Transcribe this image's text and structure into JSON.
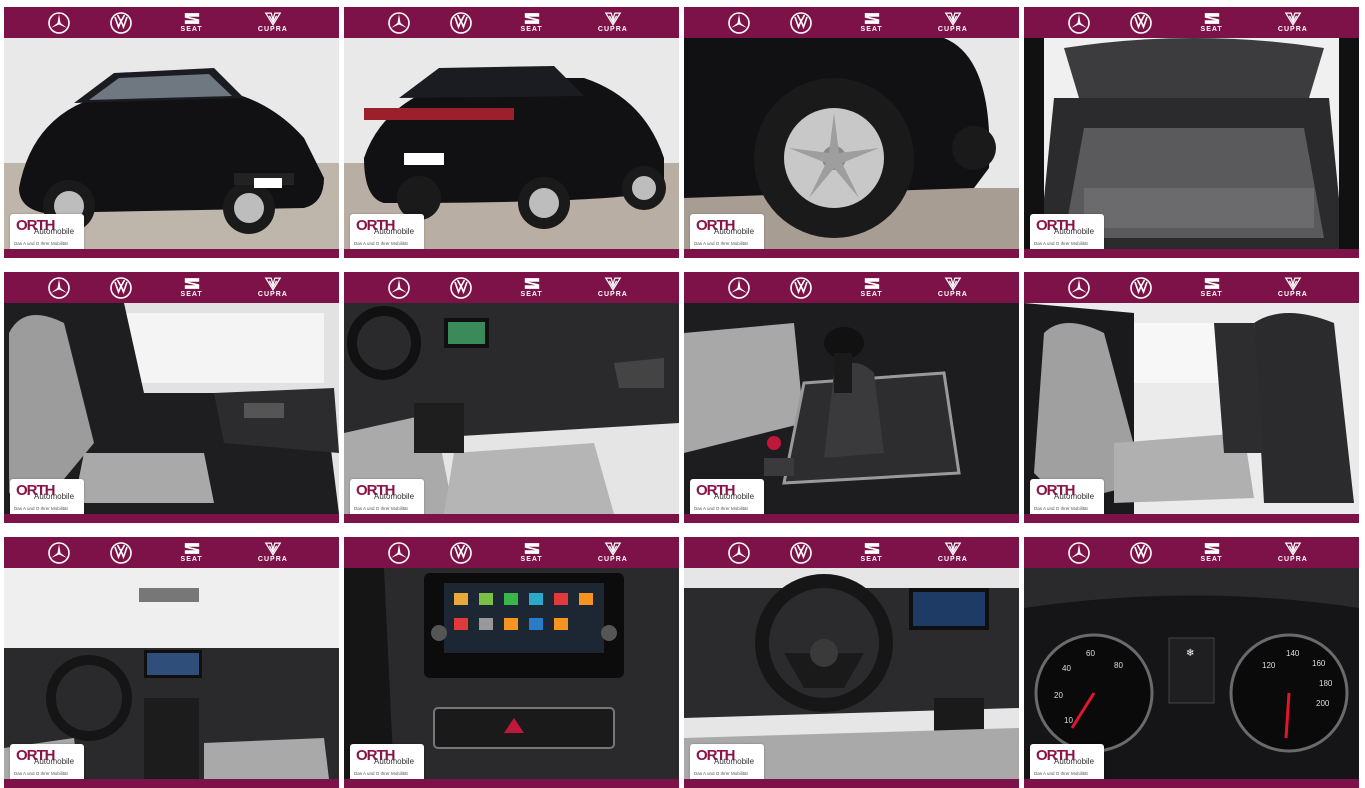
{
  "brands": {
    "seat": "SEAT",
    "cupra": "CUPRA"
  },
  "dealer": {
    "name": "ORTH",
    "sub": "Automobile",
    "tag": "Das A und O Ihrer Mobilität"
  },
  "colors": {
    "brand_bar": "#7d1248",
    "car_paint": "#111114",
    "upholstery": "#a9a9a9"
  },
  "photos": [
    {
      "subject": "front-three-quarter"
    },
    {
      "subject": "rear-three-quarter"
    },
    {
      "subject": "wheel"
    },
    {
      "subject": "trunk"
    },
    {
      "subject": "front-seats"
    },
    {
      "subject": "dashboard-side"
    },
    {
      "subject": "gear-shifter"
    },
    {
      "subject": "rear-seats"
    },
    {
      "subject": "cockpit"
    },
    {
      "subject": "infotainment"
    },
    {
      "subject": "steering-wheel"
    },
    {
      "subject": "instrument-cluster"
    }
  ],
  "cluster_display": {
    "left_ticks": [
      "40",
      "60",
      "80",
      "20",
      "10"
    ],
    "right_ticks": [
      "120",
      "140",
      "160",
      "180",
      "200"
    ]
  }
}
